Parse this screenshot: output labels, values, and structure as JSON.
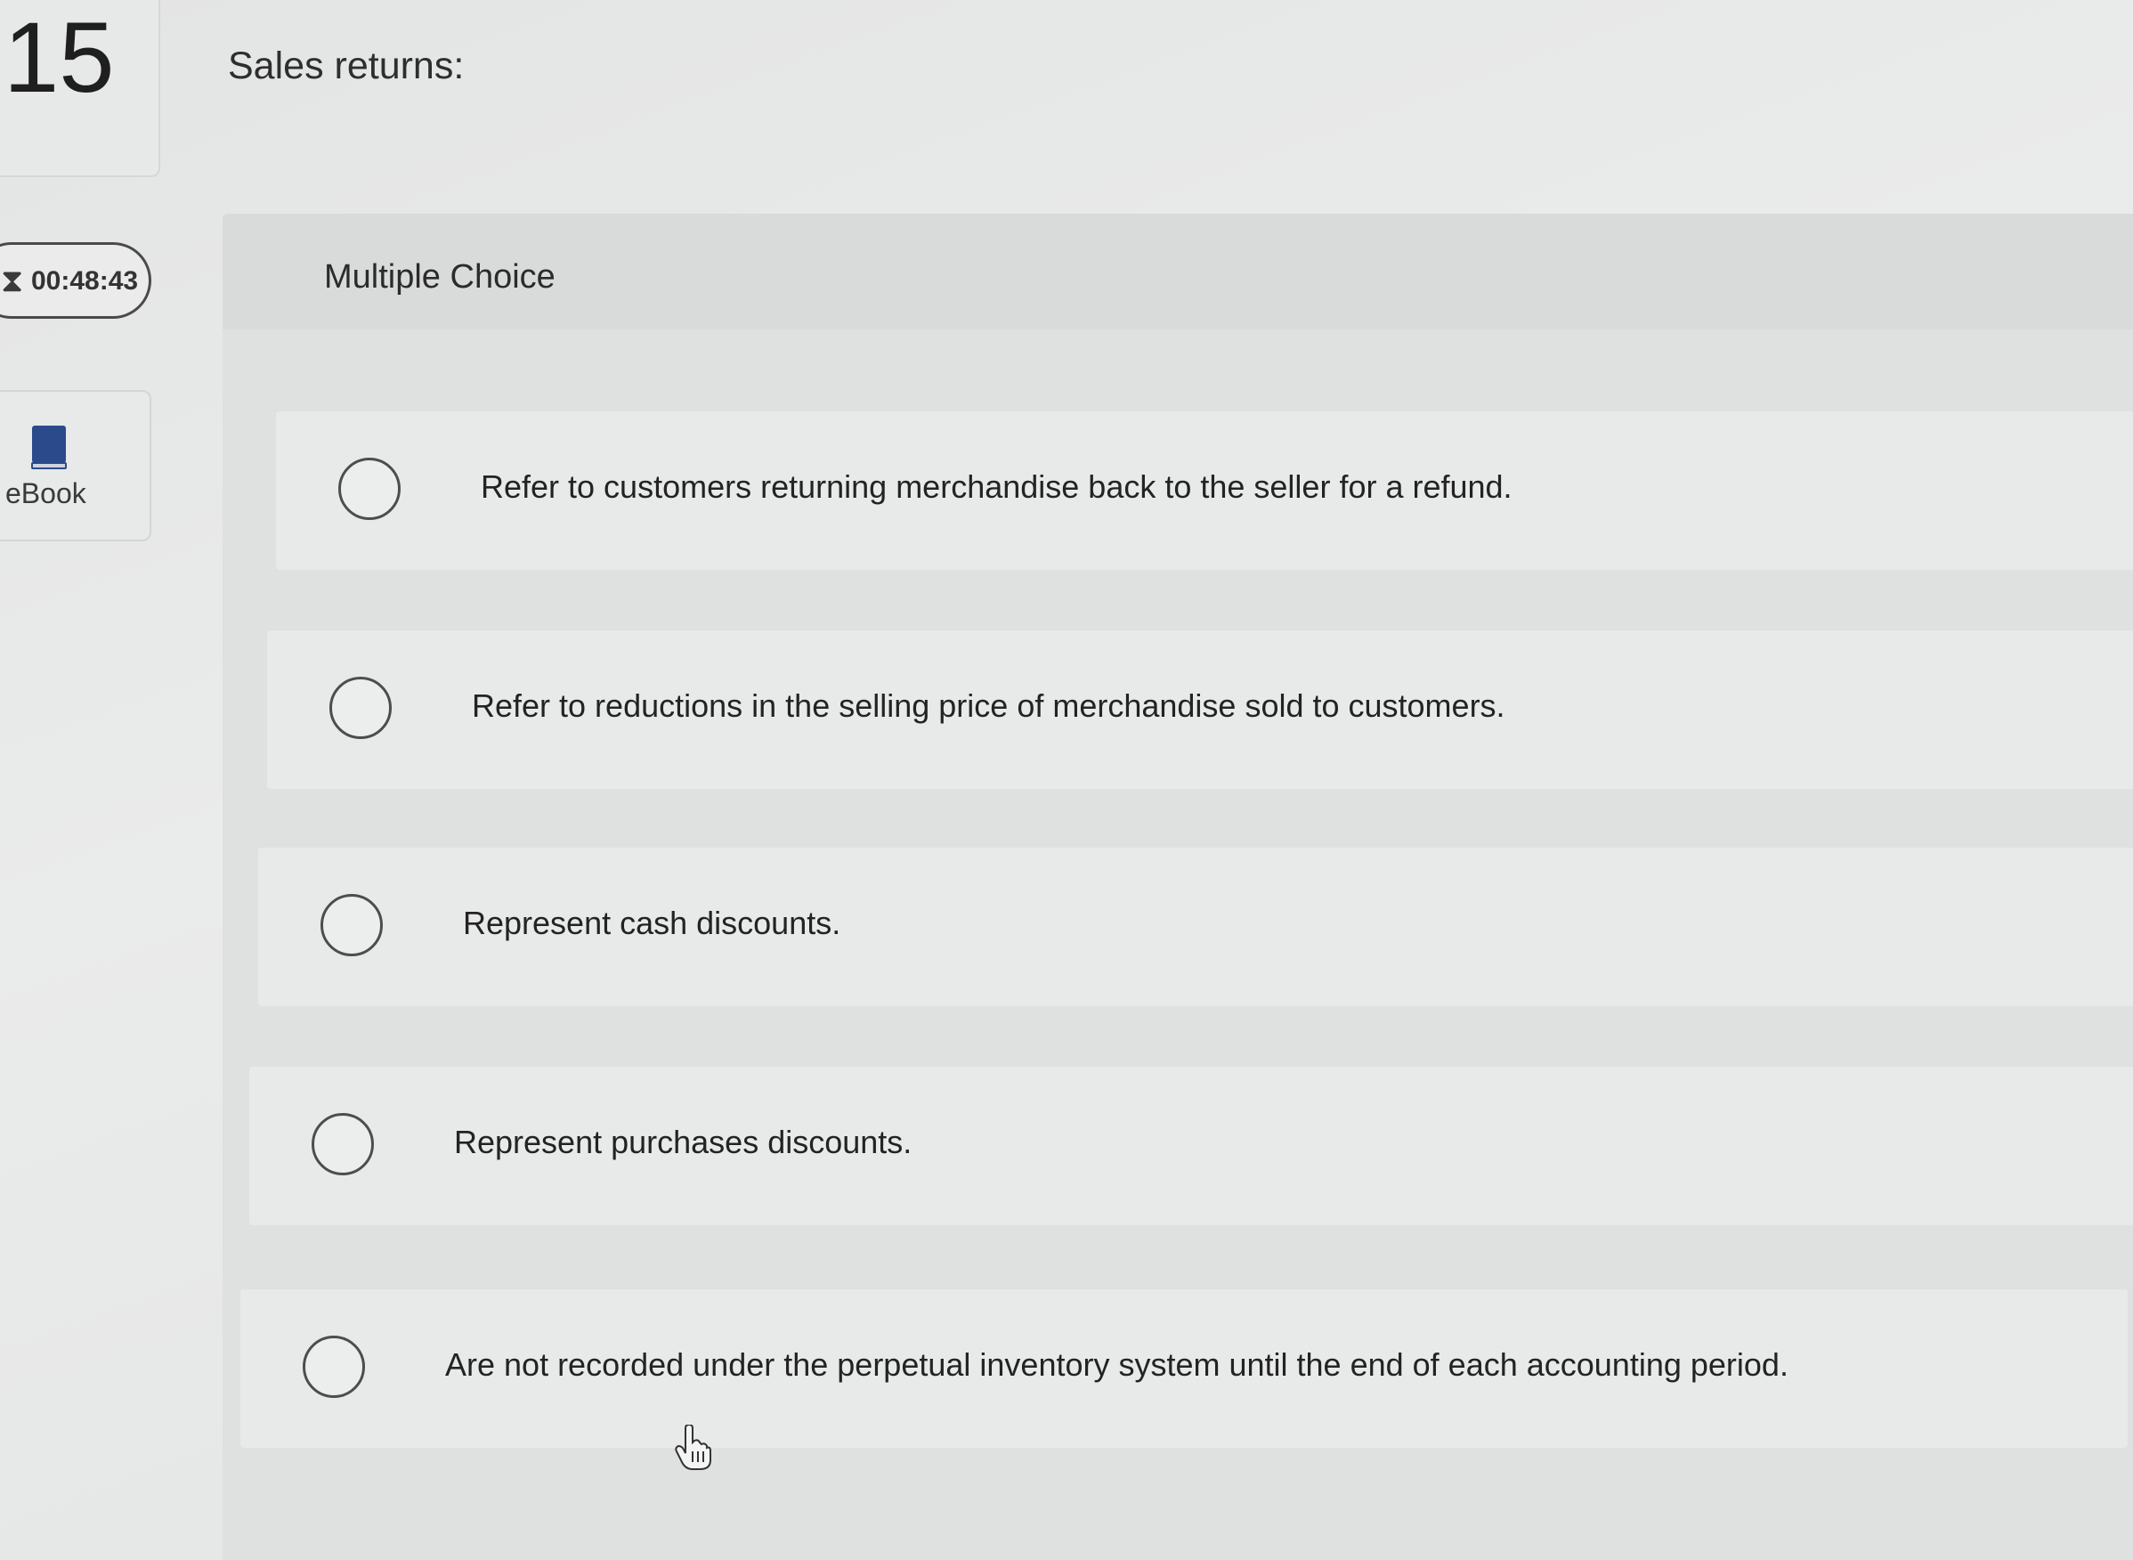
{
  "question": {
    "number": "15",
    "text": "Sales returns:"
  },
  "timer": {
    "value": "00:48:43",
    "icon": "hourglass-icon"
  },
  "ebook": {
    "label": "eBook",
    "icon": "book-icon",
    "color": "#2b4a8c"
  },
  "answer_section": {
    "type_label": "Multiple Choice",
    "options": [
      {
        "label": "Refer to customers returning merchandise back to the seller for a refund.",
        "selected": false
      },
      {
        "label": "Refer to reductions in the selling price of merchandise sold to customers.",
        "selected": false
      },
      {
        "label": "Represent cash discounts.",
        "selected": false
      },
      {
        "label": "Represent purchases discounts.",
        "selected": false
      },
      {
        "label": "Are not recorded under the perpetual inventory system until the end of each accounting period.",
        "selected": false
      }
    ]
  }
}
